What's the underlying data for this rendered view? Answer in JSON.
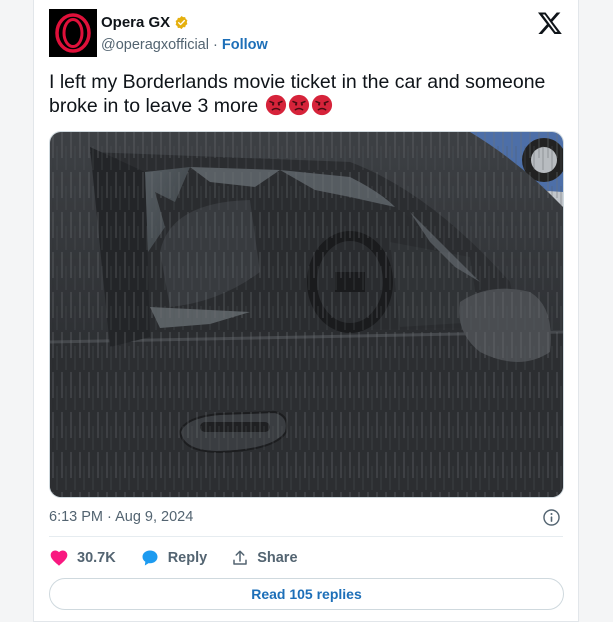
{
  "author": {
    "name": "Opera GX",
    "handle": "@operagxofficial",
    "separator": "·",
    "follow_label": "Follow"
  },
  "tweet": {
    "text": "I left my Borderlands movie ticket in the car and someone broke in to leave 3 more",
    "emoji_count": 3,
    "emoji_name": "angry-face",
    "image_alt": "Parked dark car with smashed driver's side window",
    "timestamp": "6:13 PM · Aug 9, 2024"
  },
  "actions": {
    "likes": "30.7K",
    "reply_label": "Reply",
    "share_label": "Share"
  },
  "read_replies_label": "Read 105 replies",
  "colors": {
    "accent": "#1d6fb8",
    "heart": "#f91880",
    "reply_bubble": "#1d9bf0",
    "muted_text": "#536471",
    "verified_badge": "#e5b00e",
    "opera_red": "#e0103a"
  },
  "icons": [
    "opera-gx-logo",
    "verified-badge-icon",
    "x-logo-icon",
    "angry-face-emoji",
    "info-icon",
    "heart-icon",
    "reply-bubble-icon",
    "share-icon"
  ]
}
